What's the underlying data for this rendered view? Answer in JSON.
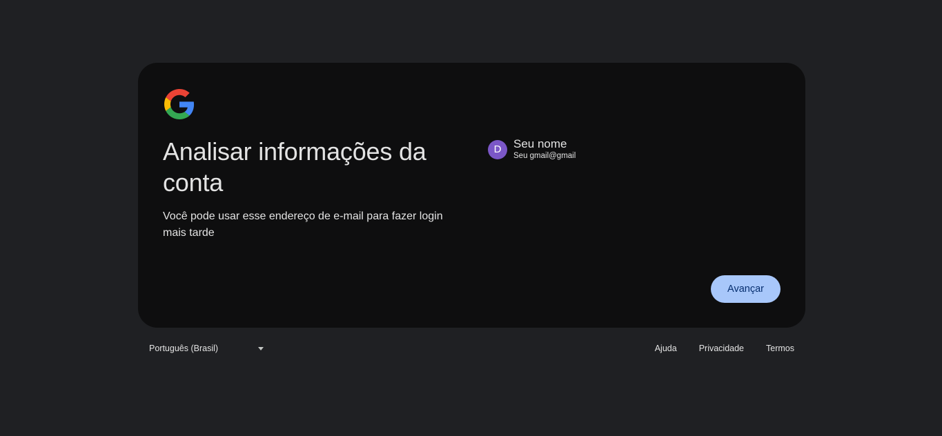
{
  "card": {
    "heading": "Analisar informações da conta",
    "subtext": "Você pode usar esse endereço de e-mail para fazer login mais tarde",
    "logo_icon": "google-g-icon"
  },
  "account": {
    "avatar_initial": "D",
    "avatar_color": "#7b57c7",
    "name": "Seu nome",
    "email": "Seu gmail@gmail"
  },
  "actions": {
    "next_label": "Avançar",
    "accent_color": "#a8c7fa"
  },
  "footer": {
    "language": "Português (Brasil)",
    "language_icon": "caret-down-icon",
    "links": [
      "Ajuda",
      "Privacidade",
      "Termos"
    ]
  }
}
